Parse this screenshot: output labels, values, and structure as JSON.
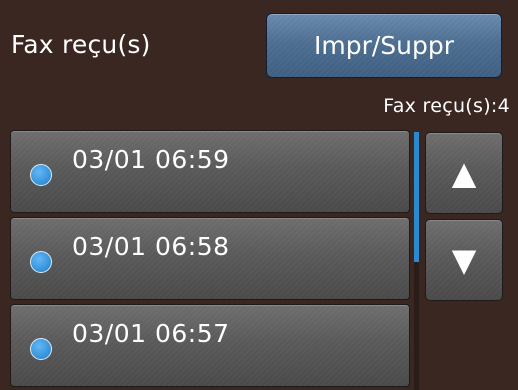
{
  "header": {
    "title": "Fax reçu(s)",
    "action_button_label": "Impr/Suppr"
  },
  "status": {
    "count_text": "Fax reçu(s):4"
  },
  "fax_list": {
    "items": [
      {
        "label": "03/01 06:59",
        "selected": false
      },
      {
        "label": "03/01 06:58",
        "selected": false
      },
      {
        "label": "03/01 06:57",
        "selected": false
      }
    ]
  },
  "nav": {
    "up_glyph": "▲",
    "down_glyph": "▼"
  },
  "colors": {
    "background": "#3a2722",
    "accent_button": "#4d6e91",
    "radio": "#3a95dc",
    "scroll_thumb": "#2b89d0"
  },
  "icons": {
    "up": "up-arrow-icon",
    "down": "down-arrow-icon",
    "radio": "radio-button-icon"
  }
}
